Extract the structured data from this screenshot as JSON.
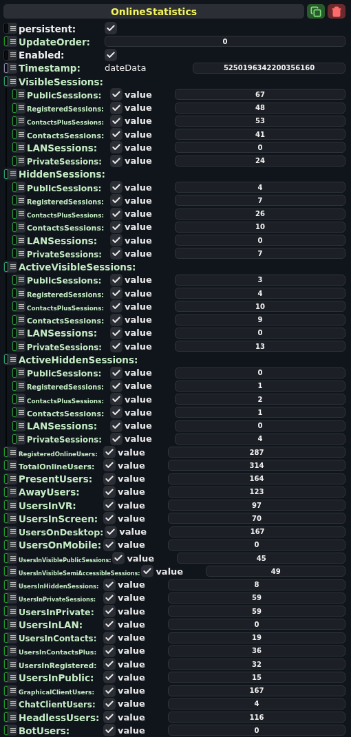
{
  "header": {
    "title": "OnlineStatistics"
  },
  "fields": [
    {
      "kind": "checkbox",
      "label": "persistent:",
      "color": "#050505",
      "checked": true
    },
    {
      "kind": "number",
      "label": "UpdateOrder:",
      "color": "#1e9a1e",
      "value": "0"
    },
    {
      "kind": "checkbox",
      "label": "Enabled:",
      "color": "#050505",
      "checked": true
    },
    {
      "kind": "date",
      "label": "Timestamp:",
      "color": "#8a8aa8",
      "type_label": "dateData",
      "value": "5250196342200356160"
    }
  ],
  "groups": [
    {
      "label": "VisibleSessions:",
      "children": [
        {
          "label": "PublicSessions:",
          "checked": true,
          "check_label": "value",
          "value": "67"
        },
        {
          "label": "RegisteredSessions:",
          "checked": true,
          "check_label": "value",
          "value": "48"
        },
        {
          "label": "ContactsPlusSessions:",
          "checked": true,
          "check_label": "value",
          "value": "53"
        },
        {
          "label": "ContactsSessions:",
          "checked": true,
          "check_label": "value",
          "value": "41"
        },
        {
          "label": "LANSessions:",
          "checked": true,
          "check_label": "value",
          "value": "0"
        },
        {
          "label": "PrivateSessions:",
          "checked": true,
          "check_label": "value",
          "value": "24"
        }
      ]
    },
    {
      "label": "HiddenSessions:",
      "children": [
        {
          "label": "PublicSessions:",
          "checked": true,
          "check_label": "value",
          "value": "4"
        },
        {
          "label": "RegisteredSessions:",
          "checked": true,
          "check_label": "value",
          "value": "7"
        },
        {
          "label": "ContactsPlusSessions:",
          "checked": true,
          "check_label": "value",
          "value": "26"
        },
        {
          "label": "ContactsSessions:",
          "checked": true,
          "check_label": "value",
          "value": "10"
        },
        {
          "label": "LANSessions:",
          "checked": true,
          "check_label": "value",
          "value": "0"
        },
        {
          "label": "PrivateSessions:",
          "checked": true,
          "check_label": "value",
          "value": "7"
        }
      ]
    },
    {
      "label": "ActiveVisibleSessions:",
      "children": [
        {
          "label": "PublicSessions:",
          "checked": true,
          "check_label": "value",
          "value": "3"
        },
        {
          "label": "RegisteredSessions:",
          "checked": true,
          "check_label": "value",
          "value": "4"
        },
        {
          "label": "ContactsPlusSessions:",
          "checked": true,
          "check_label": "value",
          "value": "10"
        },
        {
          "label": "ContactsSessions:",
          "checked": true,
          "check_label": "value",
          "value": "9"
        },
        {
          "label": "LANSessions:",
          "checked": true,
          "check_label": "value",
          "value": "0"
        },
        {
          "label": "PrivateSessions:",
          "checked": true,
          "check_label": "value",
          "value": "13"
        }
      ]
    },
    {
      "label": "ActiveHiddenSessions:",
      "children": [
        {
          "label": "PublicSessions:",
          "checked": true,
          "check_label": "value",
          "value": "0"
        },
        {
          "label": "RegisteredSessions:",
          "checked": true,
          "check_label": "value",
          "value": "1"
        },
        {
          "label": "ContactsPlusSessions:",
          "checked": true,
          "check_label": "value",
          "value": "2"
        },
        {
          "label": "ContactsSessions:",
          "checked": true,
          "check_label": "value",
          "value": "1"
        },
        {
          "label": "LANSessions:",
          "checked": true,
          "check_label": "value",
          "value": "0"
        },
        {
          "label": "PrivateSessions:",
          "checked": true,
          "check_label": "value",
          "value": "4"
        }
      ]
    }
  ],
  "users": [
    {
      "label": "RegisteredOnlineUsers:",
      "checked": true,
      "check_label": "value",
      "value": "287"
    },
    {
      "label": "TotalOnlineUsers:",
      "checked": true,
      "check_label": "value",
      "value": "314"
    },
    {
      "label": "PresentUsers:",
      "checked": true,
      "check_label": "value",
      "value": "164"
    },
    {
      "label": "AwayUsers:",
      "checked": true,
      "check_label": "value",
      "value": "123"
    },
    {
      "label": "UsersInVR:",
      "checked": true,
      "check_label": "value",
      "value": "97"
    },
    {
      "label": "UsersInScreen:",
      "checked": true,
      "check_label": "value",
      "value": "70"
    },
    {
      "label": "UsersOnDesktop:",
      "checked": true,
      "check_label": "value",
      "value": "167"
    },
    {
      "label": "UsersOnMobile:",
      "checked": true,
      "check_label": "value",
      "value": "0"
    },
    {
      "label": "UsersInVisiblePublicSessions:",
      "checked": true,
      "check_label": "value",
      "value": "45"
    },
    {
      "label": "UsersInVisibleSemiAccessibleSessions:",
      "checked": true,
      "check_label": "value",
      "value": "49"
    },
    {
      "label": "UsersInHiddenSessions:",
      "checked": true,
      "check_label": "value",
      "value": "8"
    },
    {
      "label": "UsersInPrivateSessions:",
      "checked": true,
      "check_label": "value",
      "value": "59"
    },
    {
      "label": "UsersInPrivate:",
      "checked": true,
      "check_label": "value",
      "value": "59"
    },
    {
      "label": "UsersInLAN:",
      "checked": true,
      "check_label": "value",
      "value": "0"
    },
    {
      "label": "UsersInContacts:",
      "checked": true,
      "check_label": "value",
      "value": "19"
    },
    {
      "label": "UsersInContactsPlus:",
      "checked": true,
      "check_label": "value",
      "value": "36"
    },
    {
      "label": "UsersInRegistered:",
      "checked": true,
      "check_label": "value",
      "value": "32"
    },
    {
      "label": "UsersInPublic:",
      "checked": true,
      "check_label": "value",
      "value": "15"
    },
    {
      "label": "GraphicalClientUsers:",
      "checked": true,
      "check_label": "value",
      "value": "167"
    },
    {
      "label": "ChatClientUsers:",
      "checked": true,
      "check_label": "value",
      "value": "4"
    },
    {
      "label": "HeadlessUsers:",
      "checked": true,
      "check_label": "value",
      "value": "116"
    },
    {
      "label": "BotUsers:",
      "checked": true,
      "check_label": "value",
      "value": "0"
    }
  ]
}
